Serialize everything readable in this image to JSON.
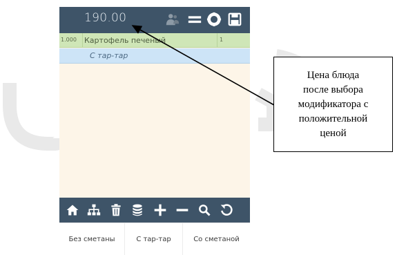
{
  "header": {
    "price": "190.00",
    "icons": [
      "users-icon",
      "menu-icon",
      "settings-icon",
      "save-icon"
    ]
  },
  "order": {
    "quantity": "1.000",
    "item_name": "Картофель печеный",
    "count": "1",
    "modifier": "С тар-тар"
  },
  "toolbar": {
    "icons": [
      "home-icon",
      "sitemap-icon",
      "trash-icon",
      "database-icon",
      "plus-icon",
      "minus-icon",
      "search-icon",
      "refresh-icon"
    ]
  },
  "modifiers": [
    {
      "label": "Без сметаны"
    },
    {
      "label": "С тар-тар"
    },
    {
      "label": "Со сметаной"
    }
  ],
  "callout": {
    "text": "Цена блюда\nпосле выбора\nмодификатора с\nположительной\nценой"
  },
  "colors": {
    "topbar": "#3e5468",
    "order_row": "#cfe6b7",
    "modifier_row": "#cde4f7",
    "list_bg": "#fdf5e8"
  }
}
